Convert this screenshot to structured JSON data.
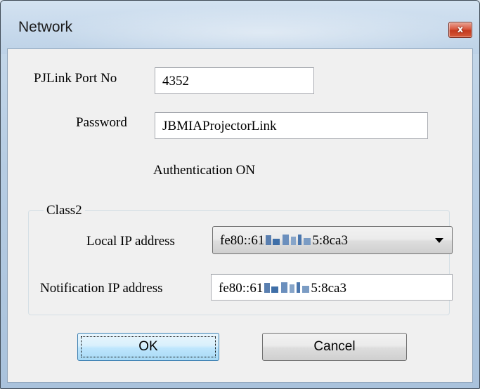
{
  "window": {
    "title": "Network",
    "close_glyph": "x"
  },
  "form": {
    "port_label": "PJLink Port No",
    "port_value": "4352",
    "password_label": "Password",
    "password_value": "JBMIAProjectorLink",
    "auth_status": "Authentication ON"
  },
  "class2": {
    "legend": "Class2",
    "local_ip_label": "Local IP address",
    "local_ip_value": "fe80::61",
    "local_ip_tail": "5:8ca3",
    "notification_ip_label": "Notification IP address",
    "notification_ip_value": "fe80::61",
    "notification_ip_tail": "5:8ca3"
  },
  "buttons": {
    "ok_label": "OK",
    "cancel_label": "Cancel"
  },
  "colors": {
    "close_button": "#d9583f",
    "default_button_border": "#3c7fb1",
    "client_background": "#f0f0f0"
  },
  "icons": {
    "close": "close-icon",
    "dropdown": "chevron-down-icon"
  }
}
